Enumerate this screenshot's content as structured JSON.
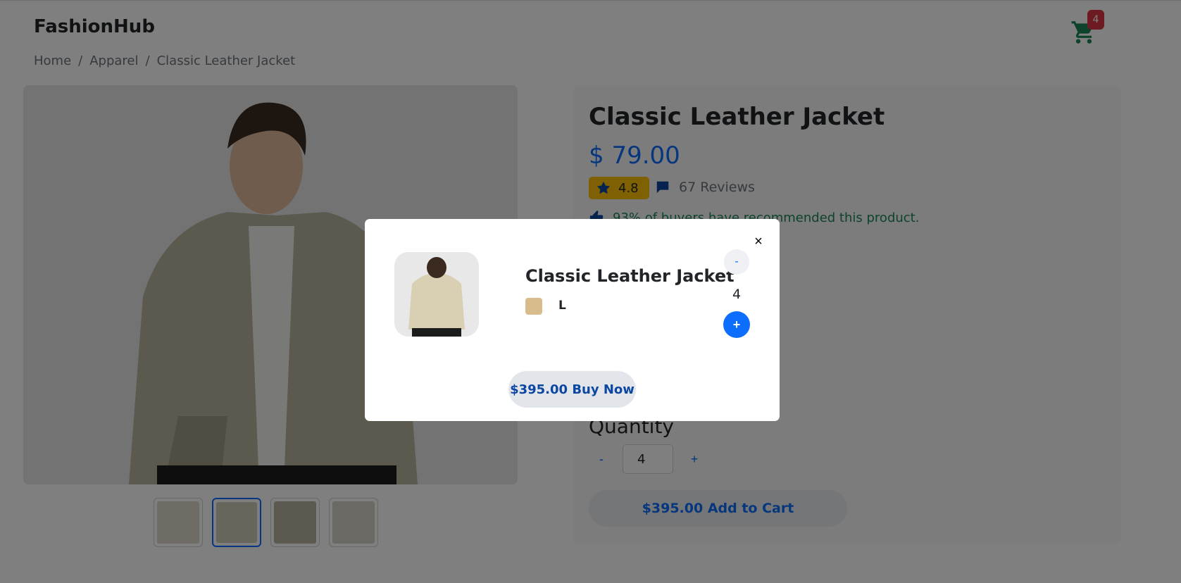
{
  "header": {
    "brand": "FashionHub",
    "cart_count": "4"
  },
  "breadcrumb": {
    "items": [
      "Home",
      "Apparel",
      "Classic Leather Jacket"
    ],
    "separator": "/"
  },
  "gallery": {
    "thumbnails_count": 4,
    "active_index": 1
  },
  "product": {
    "title": "Classic Leather Jacket",
    "price": "$ 79.00",
    "rating": "4.8",
    "reviews": "67 Reviews",
    "recommendation": "93% of buyers have recommended this product.",
    "quantity_label": "Quantity",
    "quantity_minus": "-",
    "quantity_value": "4",
    "quantity_plus": "+",
    "add_to_cart": "$395.00 Add to Cart"
  },
  "modal": {
    "close_label": "×",
    "title": "Classic Leather Jacket",
    "color": "#d9bc8c",
    "size": "L",
    "minus": "-",
    "quantity": "4",
    "plus": "+",
    "buy_now": "$395.00 Buy Now"
  },
  "colors": {
    "accent": "#0d6efd",
    "badge": "#dc3545",
    "rating": "#ffc107",
    "cart_icon": "#198754",
    "success": "#198754"
  }
}
